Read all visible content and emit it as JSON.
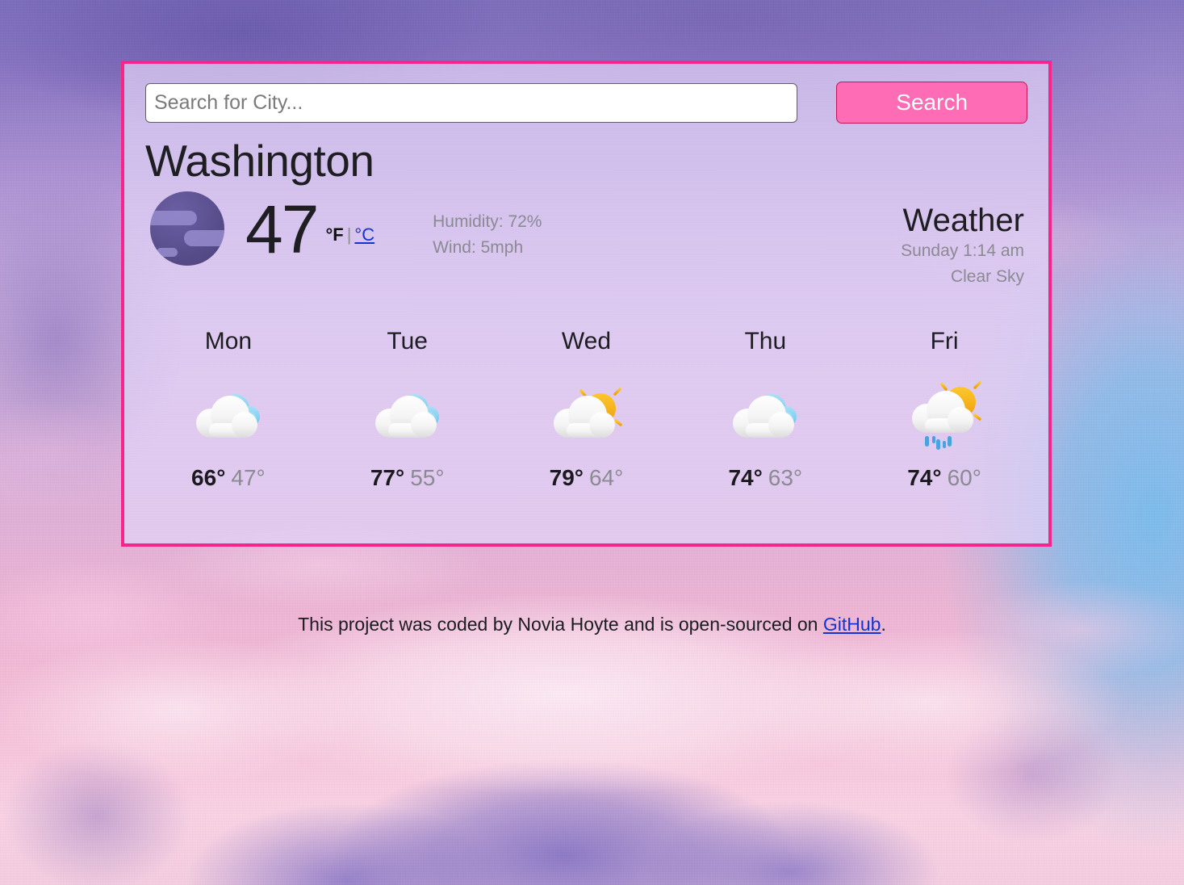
{
  "search": {
    "placeholder": "Search for City...",
    "value": "",
    "button_label": "Search"
  },
  "current": {
    "city": "Washington",
    "icon": "night-cloudy-icon",
    "temperature": "47",
    "unit_fahrenheit": "°F",
    "unit_separator": "|",
    "unit_celsius": "°C",
    "humidity": "Humidity: 72%",
    "wind": "Wind: 5mph",
    "heading": "Weather",
    "datetime": "Sunday 1:14 am",
    "description": "Clear Sky"
  },
  "forecast": [
    {
      "day": "Mon",
      "icon": "cloudy-icon",
      "high": "66°",
      "low": "47°"
    },
    {
      "day": "Tue",
      "icon": "cloudy-icon",
      "high": "77°",
      "low": "55°"
    },
    {
      "day": "Wed",
      "icon": "partly-sunny-icon",
      "high": "79°",
      "low": "64°"
    },
    {
      "day": "Thu",
      "icon": "cloudy-icon",
      "high": "74°",
      "low": "63°"
    },
    {
      "day": "Fri",
      "icon": "sun-rain-icon",
      "high": "74°",
      "low": "60°"
    }
  ],
  "footer": {
    "text_before": "This project was coded by Novia Hoyte and is open-sourced on ",
    "link_label": "GitHub",
    "text_after": "."
  },
  "colors": {
    "card_border": "#f7248c",
    "search_button": "#fd6cb4",
    "search_button_border": "#c2185b",
    "link": "#1034d6",
    "muted_text": "#8a8a92",
    "primary_text": "#1e1e22"
  }
}
